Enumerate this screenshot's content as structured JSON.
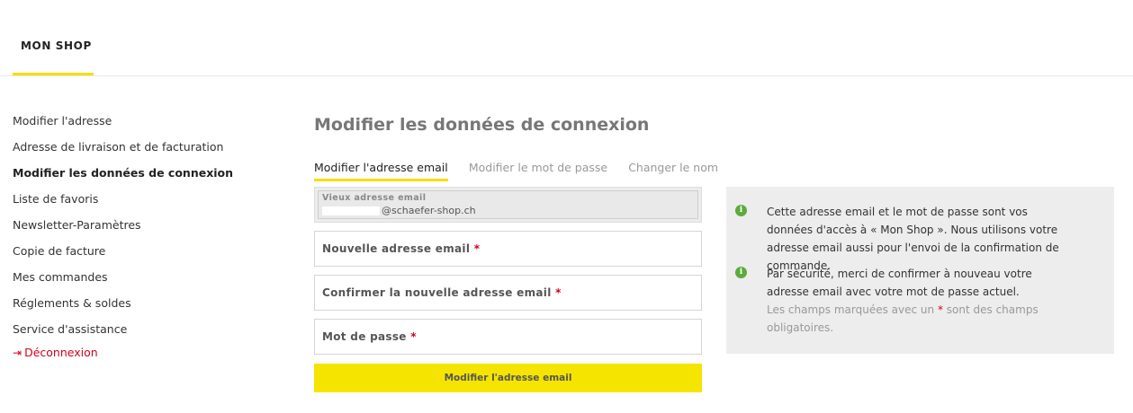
{
  "header": {
    "brand": "MON SHOP"
  },
  "sidebar": {
    "items": [
      {
        "label": "Modifier l'adresse"
      },
      {
        "label": "Adresse de livraison et de facturation"
      },
      {
        "label": "Modifier les données de connexion"
      },
      {
        "label": "Liste de favoris"
      },
      {
        "label": "Newsletter-Paramètres"
      },
      {
        "label": "Copie de facture"
      },
      {
        "label": "Mes commandes"
      },
      {
        "label": "Réglements & soldes"
      },
      {
        "label": "Service d'assistance"
      }
    ],
    "logout_label": "Déconnexion",
    "logout_icon": "logout-icon",
    "active_index": 2
  },
  "main": {
    "title": "Modifier les données de connexion",
    "tabs": [
      {
        "label": "Modifier l'adresse email",
        "active": true
      },
      {
        "label": "Modifier le mot de passe",
        "active": false
      },
      {
        "label": "Changer le nom",
        "active": false
      }
    ],
    "form": {
      "old_email_label": "Vieux adresse email",
      "old_email_value": "@schaefer-shop.ch",
      "new_email_label": "Nouvelle adresse email",
      "confirm_email_label": "Confirmer la nouvelle adresse email",
      "password_label": "Mot de passe",
      "required_mark": "*",
      "submit_label": "Modifier l'adresse email"
    },
    "info": {
      "icon": "info-icon",
      "message_1": "Cette adresse email et le mot de passe sont vos données d'accès à « Mon Shop ». Nous utilisons votre adresse email aussi pour l'envoi de la confirmation de commande.",
      "message_2": "Par sécurité, merci de confirmer à nouveau votre adresse email avec votre mot de passe actuel.",
      "note_prefix": "Les champs marquées avec un",
      "note_star": "*",
      "note_suffix": "sont des champs obligatoires."
    }
  },
  "colors": {
    "accent": "#f5e400",
    "required": "#d0021b",
    "info_icon": "#5cab3c",
    "info_bg": "#ededed"
  }
}
